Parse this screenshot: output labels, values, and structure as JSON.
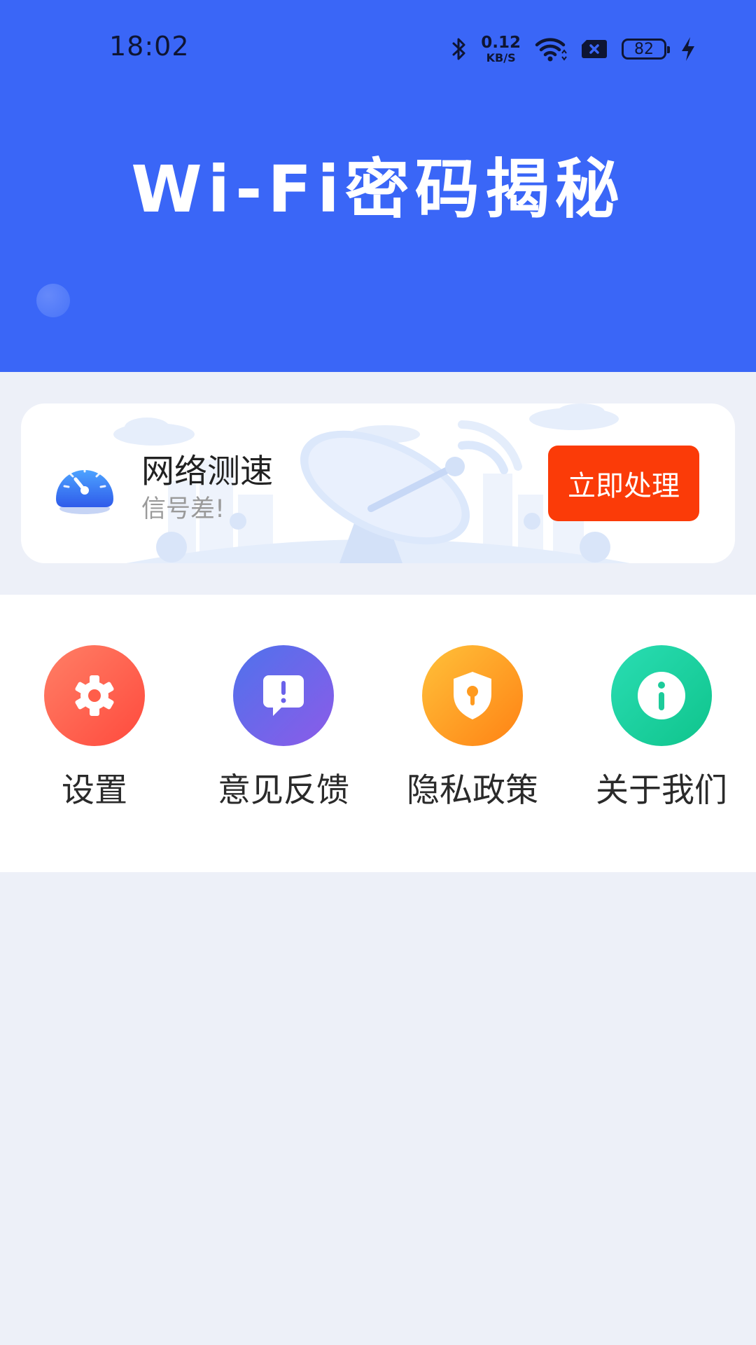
{
  "status_bar": {
    "time": "18:02",
    "net_speed_value": "0.12",
    "net_speed_unit": "KB/S",
    "battery_level": "82",
    "icons": [
      "bluetooth-icon",
      "wifi-icon",
      "sim-missing-icon",
      "battery-icon",
      "charging-icon"
    ]
  },
  "header": {
    "title": "Wi-Fi密码揭秘"
  },
  "speed_card": {
    "icon": "speedometer-icon",
    "title": "网络测速",
    "subtitle": "信号差!",
    "action_label": "立即处理"
  },
  "menu": {
    "items": [
      {
        "label": "设置",
        "icon": "gear-icon"
      },
      {
        "label": "意见反馈",
        "icon": "feedback-icon"
      },
      {
        "label": "隐私政策",
        "icon": "shield-lock-icon"
      },
      {
        "label": "关于我们",
        "icon": "info-icon"
      }
    ]
  },
  "colors": {
    "header_blue": "#3A66F7",
    "page_background": "#EDF0F8",
    "action_red": "#FB3B08",
    "settings": "#FF5A48",
    "feedback": "#6A66EA",
    "privacy": "#FF9E22",
    "about": "#1CD3A0"
  }
}
